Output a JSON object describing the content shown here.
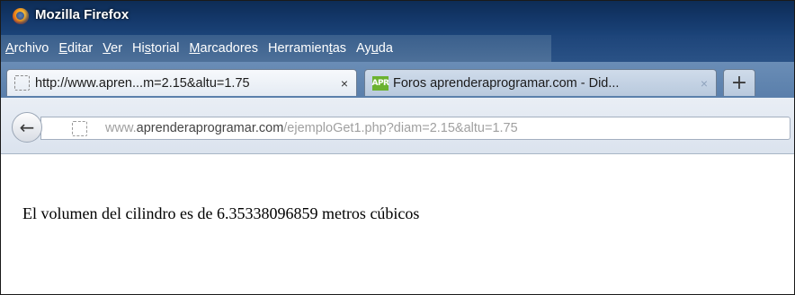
{
  "window": {
    "title": "Mozilla Firefox",
    "logo_icon": "firefox-logo-icon"
  },
  "menu": [
    {
      "pre": "",
      "u": "A",
      "post": "rchivo"
    },
    {
      "pre": "",
      "u": "E",
      "post": "ditar"
    },
    {
      "pre": "",
      "u": "V",
      "post": "er"
    },
    {
      "pre": "Hi",
      "u": "s",
      "post": "torial"
    },
    {
      "pre": "",
      "u": "M",
      "post": "arcadores"
    },
    {
      "pre": "Herramien",
      "u": "t",
      "post": "as"
    },
    {
      "pre": "Ay",
      "u": "u",
      "post": "da"
    }
  ],
  "tabs": [
    {
      "title": "http://www.apren...m=2.15&altu=1.75",
      "close": "×",
      "favicon": "blank-page-icon"
    },
    {
      "title": "Foros aprenderaprogramar.com - Did...",
      "close": "×",
      "favicon": "apr-site-icon",
      "favicon_text": "APR"
    }
  ],
  "new_tab_label": "+",
  "navbar": {
    "back_glyph": "←",
    "url_prefix": "www.",
    "url_domain": "aprenderaprogramar.com",
    "url_path": "/ejemploGet1.php?diam=2.15&altu=1.75"
  },
  "content": {
    "text": "El volumen del cilindro es de 6.35338096859 metros cúbicos"
  },
  "colors": {
    "titlebar": "#14386a",
    "menubar": "#4d7099",
    "tabstrip": "#5a7fab"
  }
}
